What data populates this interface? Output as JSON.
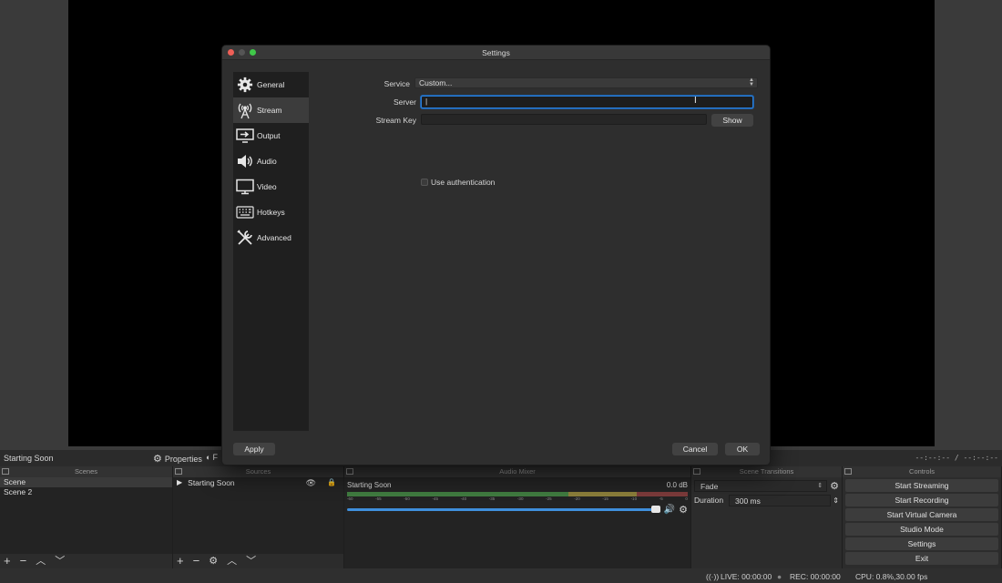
{
  "current_scene": "Starting Soon",
  "scene_bar": {
    "properties_label": "Properties",
    "filters_label": "F",
    "timecode": "--:--:-- / --:--:--"
  },
  "docks": {
    "scenes": {
      "title": "Scenes",
      "items": [
        "Scene",
        "Scene 2"
      ]
    },
    "sources": {
      "title": "Sources",
      "items": [
        "Starting Soon"
      ]
    },
    "mixer": {
      "title": "Audio Mixer",
      "channel": "Starting Soon",
      "level": "0.0 dB",
      "ticks": [
        "-60",
        "-55",
        "-50",
        "-45",
        "-40",
        "-35",
        "-30",
        "-25",
        "-20",
        "-15",
        "-10",
        "-5",
        "0"
      ]
    },
    "transitions": {
      "title": "Scene Transitions",
      "selected": "Fade",
      "duration_label": "Duration",
      "duration_value": "300 ms"
    },
    "controls": {
      "title": "Controls",
      "buttons": [
        "Start Streaming",
        "Start Recording",
        "Start Virtual Camera",
        "Studio Mode",
        "Settings",
        "Exit"
      ]
    }
  },
  "status": {
    "live": "LIVE: 00:00:00",
    "rec": "REC: 00:00:00",
    "cpu": "CPU: 0.8%,30.00 fps"
  },
  "dialog": {
    "title": "Settings",
    "nav": [
      "General",
      "Stream",
      "Output",
      "Audio",
      "Video",
      "Hotkeys",
      "Advanced"
    ],
    "active_nav": "Stream",
    "service_label": "Service",
    "service_value": "Custom...",
    "server_label": "Server",
    "server_value": "",
    "stream_key_label": "Stream Key",
    "stream_key_value": "",
    "show_label": "Show",
    "use_auth_label": "Use authentication",
    "apply_label": "Apply",
    "cancel_label": "Cancel",
    "ok_label": "OK"
  },
  "colors": {
    "accent": "#2a7fd9",
    "close": "#ee5f57",
    "zoom": "#40c849"
  }
}
